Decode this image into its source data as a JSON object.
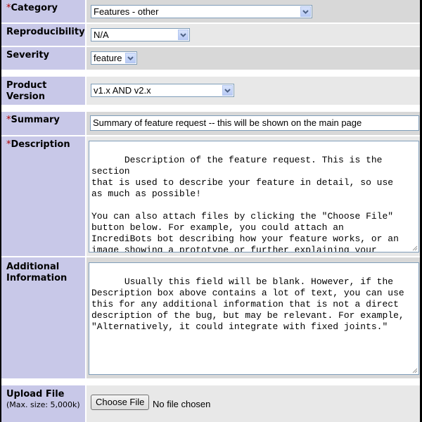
{
  "form": {
    "category": {
      "label": "Category",
      "required_marker": "*",
      "value": "Features - other"
    },
    "reproducibility": {
      "label": "Reproducibility",
      "value": "N/A"
    },
    "severity": {
      "label": "Severity",
      "value": "feature"
    },
    "product_version": {
      "label": "Product Version",
      "value": "v1.x AND v2.x"
    },
    "summary": {
      "label": "Summary",
      "required_marker": "*",
      "value": "Summary of feature request -- this will be shown on the main page"
    },
    "description": {
      "label": "Description",
      "required_marker": "*",
      "value": "Description of the feature request. This is the section\nthat is used to describe your feature in detail, so use\nas much as possible!\n\nYou can also attach files by clicking the \"Choose File\"\nbutton below. For example, you could attach an\nIncrediBots bot describing how your feature works, or an\nimage showing a prototype or further explaining your\nfeature request."
    },
    "additional_information": {
      "label": "Additional Information",
      "value": "Usually this field will be blank. However, if the\nDescription box above contains a lot of text, you can use\nthis for any additional information that is not a direct\ndescription of the bug, but may be relevant. For example,\n\"Alternatively, it could integrate with fixed joints.\""
    },
    "upload_file": {
      "label": "Upload File",
      "hint": "(Max. size: 5,000k)",
      "button_label": "Choose File",
      "status": "No file chosen"
    }
  },
  "icons": {
    "dropdown": "chevron-down-icon",
    "resize": "resize-grip-icon"
  },
  "colors": {
    "label_bg": "#c8c8e8",
    "required": "#b00000",
    "field_dark": "#d8d8d8",
    "field_light": "#e8e8e8",
    "input_border": "#7f9db9"
  }
}
